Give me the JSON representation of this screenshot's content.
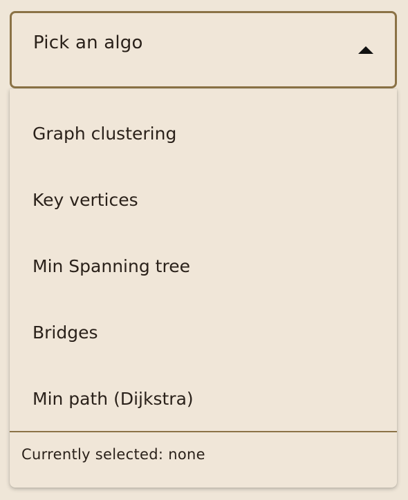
{
  "select": {
    "placeholder": "Pick an algo",
    "expanded": true,
    "icon": "chevron-up-icon"
  },
  "options": [
    {
      "label": "Graph clustering"
    },
    {
      "label": "Key vertices"
    },
    {
      "label": "Min Spanning tree"
    },
    {
      "label": "Bridges"
    },
    {
      "label": "Min path (Dijkstra)"
    }
  ],
  "status": {
    "text": "Currently selected: none"
  },
  "colors": {
    "background": "#efe6d8",
    "border": "#8b7246",
    "text": "#2a211a"
  }
}
